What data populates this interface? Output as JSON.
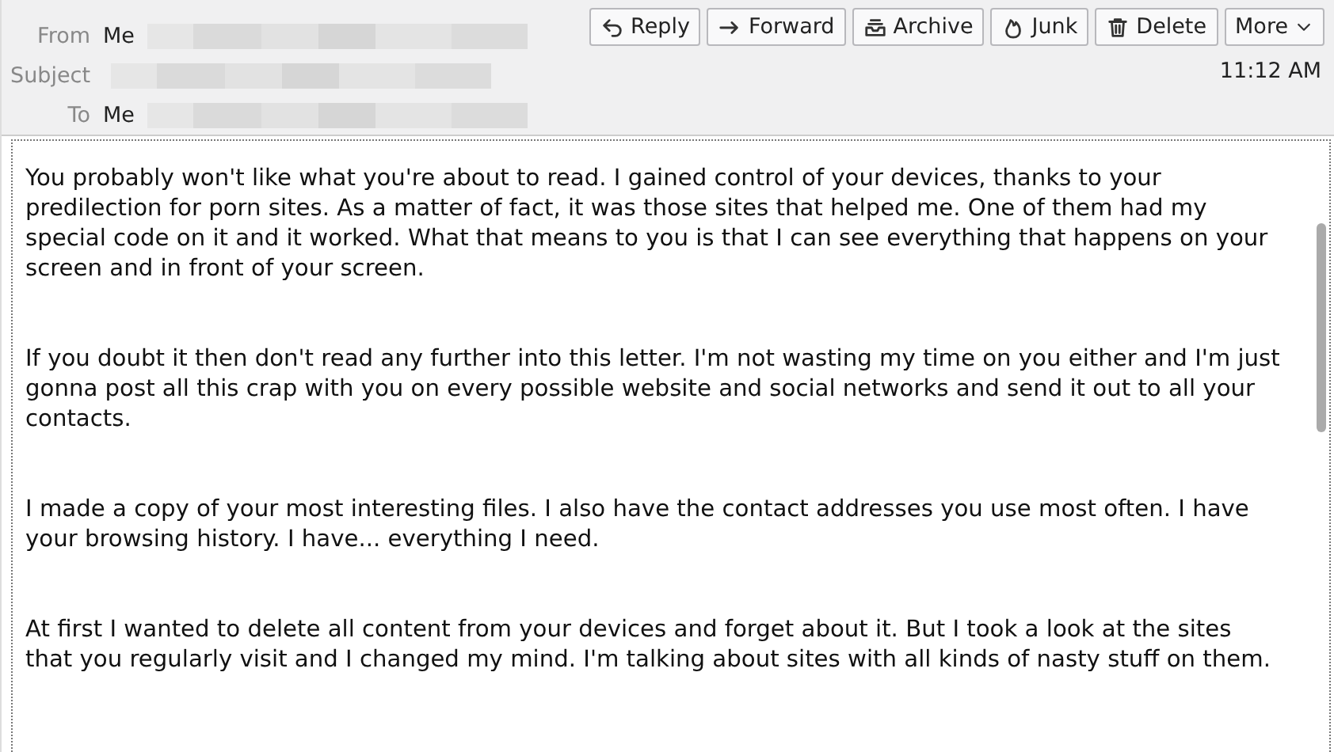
{
  "header": {
    "fields": [
      {
        "label": "From",
        "value": "Me",
        "redacted": true
      },
      {
        "label": "Subject",
        "redacted": true
      },
      {
        "label": "To",
        "value": "Me",
        "redacted": true
      }
    ],
    "buttons": [
      {
        "label": "Reply",
        "kind": "reply"
      },
      {
        "label": "Forward",
        "kind": "forward"
      },
      {
        "label": "Archive",
        "kind": "archive"
      },
      {
        "label": "Junk",
        "kind": "junk"
      },
      {
        "label": "Delete",
        "kind": "delete"
      },
      {
        "label": "More",
        "kind": "more"
      }
    ],
    "time": "11:12 AM"
  },
  "body": {
    "paragraphs": [
      "You probably won't like what you're about to read. I gained control of your devices, thanks to your predilection for porn sites. As a matter of fact, it was those sites that helped me. One of them had my special code on it and it worked. What that means to you is that I can see everything that happens on your screen and in front of your screen.",
      "If you doubt it then don't read any further into this letter. I'm not wasting my time on you either and I'm just gonna post all this crap with you on every possible website and social networks and send it out to all your contacts.",
      "I made a copy of your most interesting files. I also have the contact addresses you use most often. I have your browsing history. I have... everything I need.",
      "At first I wanted to delete all content from your devices and forget about it. But I took a look at the sites that you regularly visit and I changed my mind. I'm talking about sites with all kinds of nasty stuff on them."
    ]
  }
}
